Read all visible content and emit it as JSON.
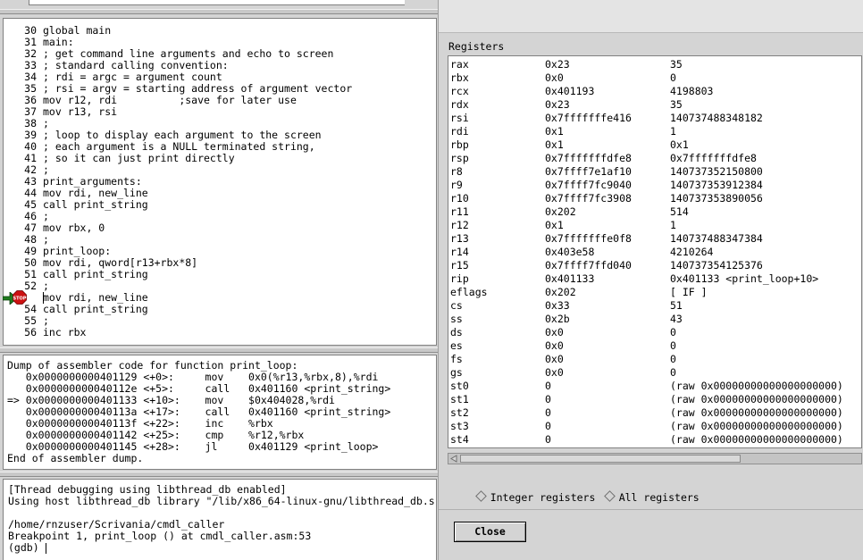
{
  "source": {
    "lines": [
      {
        "num": "30",
        "code": "global main"
      },
      {
        "num": "31",
        "code": "main:"
      },
      {
        "num": "32",
        "code": "; get command line arguments and echo to screen"
      },
      {
        "num": "33",
        "code": "; standard calling convention:"
      },
      {
        "num": "34",
        "code": "; rdi = argc = argument count"
      },
      {
        "num": "35",
        "code": "; rsi = argv = starting address of argument vector"
      },
      {
        "num": "36",
        "code": "mov r12, rdi          ;save for later use"
      },
      {
        "num": "37",
        "code": "mov r13, rsi"
      },
      {
        "num": "38",
        "code": ";"
      },
      {
        "num": "39",
        "code": "; loop to display each argument to the screen"
      },
      {
        "num": "40",
        "code": "; each argument is a NULL terminated string,"
      },
      {
        "num": "41",
        "code": "; so it can just print directly"
      },
      {
        "num": "42",
        "code": ";"
      },
      {
        "num": "43",
        "code": "print_arguments:"
      },
      {
        "num": "44",
        "code": "mov rdi, new_line"
      },
      {
        "num": "45",
        "code": "call print_string"
      },
      {
        "num": "46",
        "code": ";"
      },
      {
        "num": "47",
        "code": "mov rbx, 0"
      },
      {
        "num": "48",
        "code": ";"
      },
      {
        "num": "49",
        "code": "print_loop:"
      },
      {
        "num": "50",
        "code": "mov rdi, qword[r13+rbx*8]"
      },
      {
        "num": "51",
        "code": "call print_string"
      },
      {
        "num": "52",
        "code": ";"
      },
      {
        "num": "53",
        "code": "mov rdi, new_line"
      },
      {
        "num": "54",
        "code": "call print_string"
      },
      {
        "num": "55",
        "code": ";"
      },
      {
        "num": "56",
        "code": "inc rbx"
      }
    ],
    "breakpoint_label": "STOP",
    "breakpoint_line": "53",
    "breakpoint_line_code": "mov rdi, new_line"
  },
  "assembly": {
    "lines": [
      "Dump of assembler code for function print_loop:",
      "   0x0000000000401129 <+0>:     mov    0x0(%r13,%rbx,8),%rdi",
      "   0x000000000040112e <+5>:     call   0x401160 <print_string>",
      "=> 0x0000000000401133 <+10>:    mov    $0x404028,%rdi",
      "   0x000000000040113a <+17>:    call   0x401160 <print_string>",
      "   0x000000000040113f <+22>:    inc    %rbx",
      "   0x0000000000401142 <+25>:    cmp    %r12,%rbx",
      "   0x0000000000401145 <+28>:    jl     0x401129 <print_loop>",
      "End of assembler dump."
    ]
  },
  "console": {
    "lines": [
      "[Thread debugging using libthread_db enabled]",
      "Using host libthread_db library \"/lib/x86_64-linux-gnu/libthread_db.s",
      "",
      "/home/rnzuser/Scrivania/cmdl_caller",
      "Breakpoint 1, print_loop () at cmdl_caller.asm:53",
      "(gdb) "
    ]
  },
  "registers": {
    "heading": "Registers",
    "rows": [
      {
        "name": "rax",
        "hex": "0x23",
        "natural": "35"
      },
      {
        "name": "rbx",
        "hex": "0x0",
        "natural": "0"
      },
      {
        "name": "rcx",
        "hex": "0x401193",
        "natural": "4198803"
      },
      {
        "name": "rdx",
        "hex": "0x23",
        "natural": "35"
      },
      {
        "name": "rsi",
        "hex": "0x7fffffffe416",
        "natural": "140737488348182"
      },
      {
        "name": "rdi",
        "hex": "0x1",
        "natural": "1"
      },
      {
        "name": "rbp",
        "hex": "0x1",
        "natural": "0x1"
      },
      {
        "name": "rsp",
        "hex": "0x7fffffffdfe8",
        "natural": "0x7fffffffdfe8"
      },
      {
        "name": "r8",
        "hex": "0x7ffff7e1af10",
        "natural": "140737352150800"
      },
      {
        "name": "r9",
        "hex": "0x7ffff7fc9040",
        "natural": "140737353912384"
      },
      {
        "name": "r10",
        "hex": "0x7ffff7fc3908",
        "natural": "140737353890056"
      },
      {
        "name": "r11",
        "hex": "0x202",
        "natural": "514"
      },
      {
        "name": "r12",
        "hex": "0x1",
        "natural": "1"
      },
      {
        "name": "r13",
        "hex": "0x7fffffffe0f8",
        "natural": "140737488347384"
      },
      {
        "name": "r14",
        "hex": "0x403e58",
        "natural": "4210264"
      },
      {
        "name": "r15",
        "hex": "0x7ffff7ffd040",
        "natural": "140737354125376"
      },
      {
        "name": "rip",
        "hex": "0x401133",
        "natural": "0x401133 <print_loop+10>"
      },
      {
        "name": "eflags",
        "hex": "0x202",
        "natural": "[ IF ]"
      },
      {
        "name": "cs",
        "hex": "0x33",
        "natural": "51"
      },
      {
        "name": "ss",
        "hex": "0x2b",
        "natural": "43"
      },
      {
        "name": "ds",
        "hex": "0x0",
        "natural": "0"
      },
      {
        "name": "es",
        "hex": "0x0",
        "natural": "0"
      },
      {
        "name": "fs",
        "hex": "0x0",
        "natural": "0"
      },
      {
        "name": "gs",
        "hex": "0x0",
        "natural": "0"
      },
      {
        "name": "st0",
        "hex": "0",
        "natural": "(raw 0x00000000000000000000)"
      },
      {
        "name": "st1",
        "hex": "0",
        "natural": "(raw 0x00000000000000000000)"
      },
      {
        "name": "st2",
        "hex": "0",
        "natural": "(raw 0x00000000000000000000)"
      },
      {
        "name": "st3",
        "hex": "0",
        "natural": "(raw 0x00000000000000000000)"
      },
      {
        "name": "st4",
        "hex": "0",
        "natural": "(raw 0x00000000000000000000)"
      }
    ],
    "radio_integer": "Integer registers",
    "radio_all": "All registers",
    "close_label": "Close"
  },
  "colors": {
    "pane_bg": "#ffffff",
    "window_bg": "#d4d4d4",
    "stop_red": "#cc1111",
    "pc_arrow_green": "#1e7b1e"
  }
}
